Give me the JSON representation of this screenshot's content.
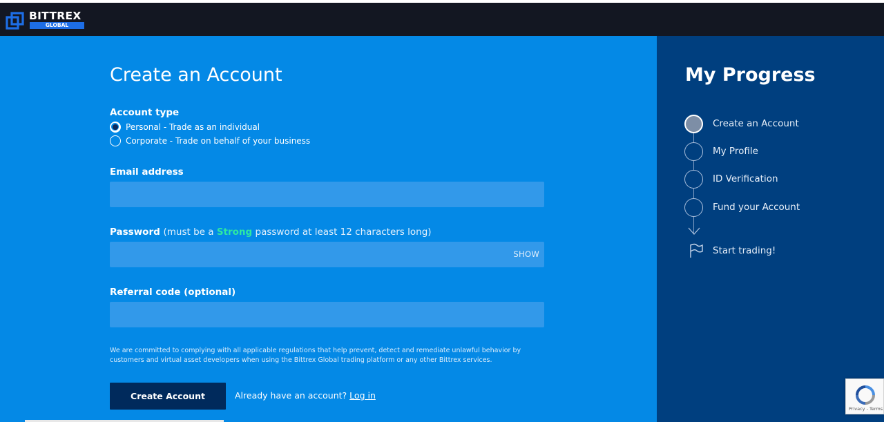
{
  "brand": {
    "name": "BITTREX",
    "sub": "GLOBAL"
  },
  "form": {
    "title": "Create an Account",
    "account_type_label": "Account type",
    "account_types": [
      {
        "label": "Personal - Trade as an individual",
        "selected": true
      },
      {
        "label": "Corporate - Trade on behalf of your business",
        "selected": false
      }
    ],
    "email_label": "Email address",
    "email_value": "",
    "password_label": "Password",
    "password_hint_pre": "(must be a ",
    "password_hint_strong": "Strong",
    "password_hint_post": " password at least 12 characters long)",
    "password_value": "",
    "show_label": "SHOW",
    "referral_label": "Referral code (optional)",
    "referral_value": "",
    "legal_text": "We are committed to complying with all applicable regulations that help prevent, detect and remediate unlawful behavior by customers and virtual asset developers when using the Bittrex Global trading platform or any other Bittrex services.",
    "submit_label": "Create Account",
    "already_text": "Already have an account?",
    "login_label": "Log in"
  },
  "progress": {
    "title": "My Progress",
    "steps": [
      {
        "label": "Create an Account",
        "active": true
      },
      {
        "label": "My Profile",
        "active": false
      },
      {
        "label": "ID Verification",
        "active": false
      },
      {
        "label": "Fund your Account",
        "active": false
      }
    ],
    "final_step": "Start trading!"
  },
  "recaptcha": {
    "text": "Privacy - Terms"
  },
  "colors": {
    "main_bg": "#0489e6",
    "side_bg": "#003f7f",
    "topbar_bg": "#131722",
    "button_bg": "#002a5c",
    "strong_accent": "#2ee9a1"
  }
}
